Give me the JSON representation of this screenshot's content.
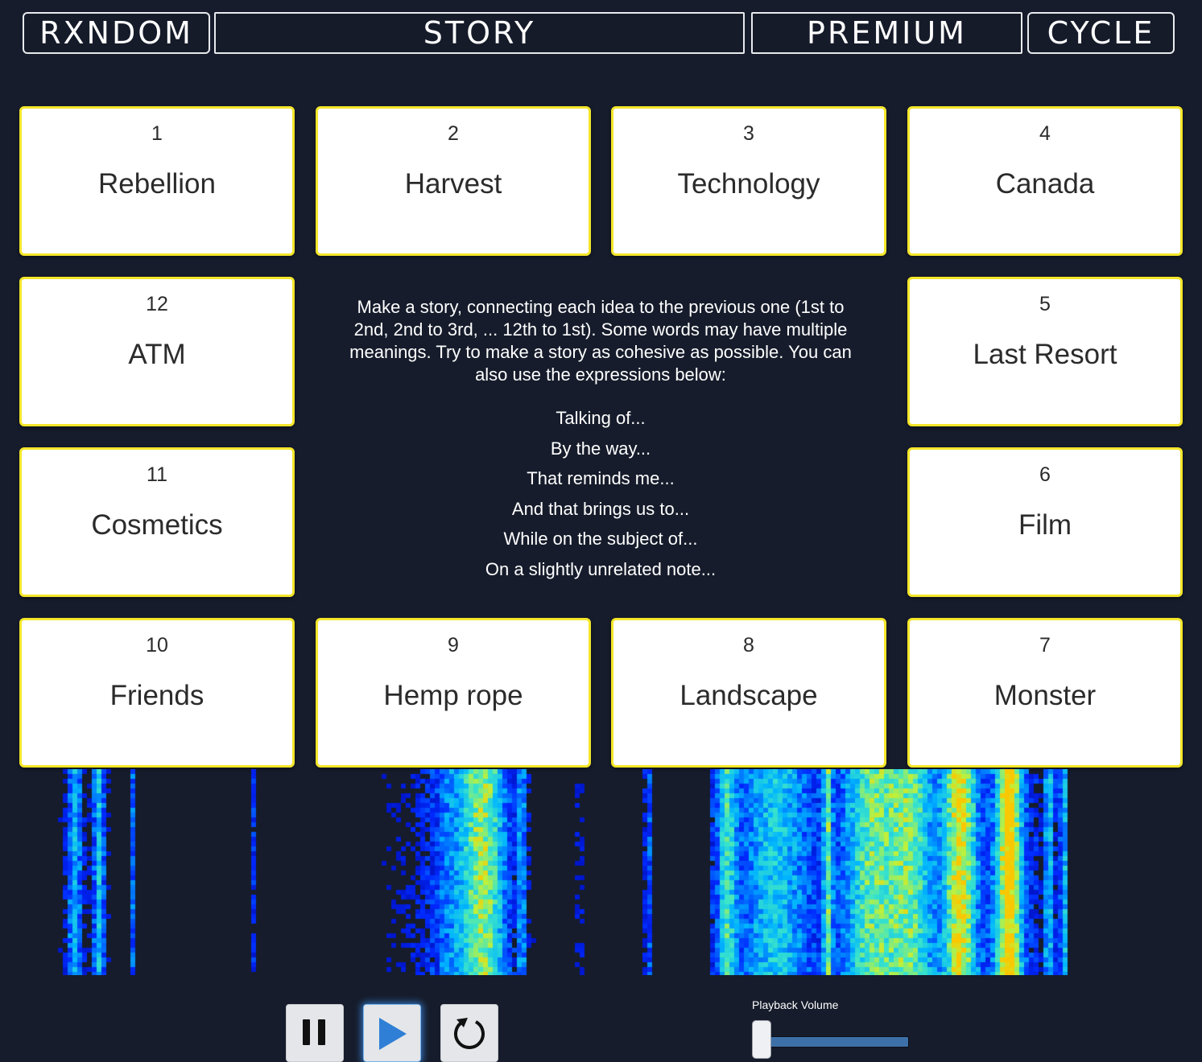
{
  "nav": {
    "random": "RXNDOM",
    "story": "STORY",
    "premium": "PREMIUM",
    "cycle": "CYCLE"
  },
  "cards": [
    {
      "number": "1",
      "word": "Rebellion"
    },
    {
      "number": "2",
      "word": "Harvest"
    },
    {
      "number": "3",
      "word": "Technology"
    },
    {
      "number": "4",
      "word": "Canada"
    },
    {
      "number": "5",
      "word": "Last Resort"
    },
    {
      "number": "6",
      "word": "Film"
    },
    {
      "number": "7",
      "word": "Monster"
    },
    {
      "number": "8",
      "word": "Landscape"
    },
    {
      "number": "9",
      "word": "Hemp rope"
    },
    {
      "number": "10",
      "word": "Friends"
    },
    {
      "number": "11",
      "word": "Cosmetics"
    },
    {
      "number": "12",
      "word": "ATM"
    }
  ],
  "instructions": {
    "text": "Make a story, connecting each idea to the previous one (1st to 2nd, 2nd to 3rd, ... 12th to 1st). Some words may have multiple meanings. Try to make a story as cohesive as possible. You can also use the expressions below:",
    "expressions": [
      "Talking of...",
      "By the way...",
      "That reminds me...",
      "And that brings us to...",
      "While on the subject of...",
      "On a slightly unrelated note..."
    ]
  },
  "controls": {
    "pause_icon": "pause-icon",
    "play_icon": "play-icon",
    "restart_icon": "restart-icon",
    "volume_label": "Playback Volume",
    "volume_level": 0.0
  },
  "colors": {
    "background": "#161c2b",
    "card_border": "#f4e62a",
    "play_icon": "#2f7fd6",
    "volume_track": "#3d70a8"
  }
}
